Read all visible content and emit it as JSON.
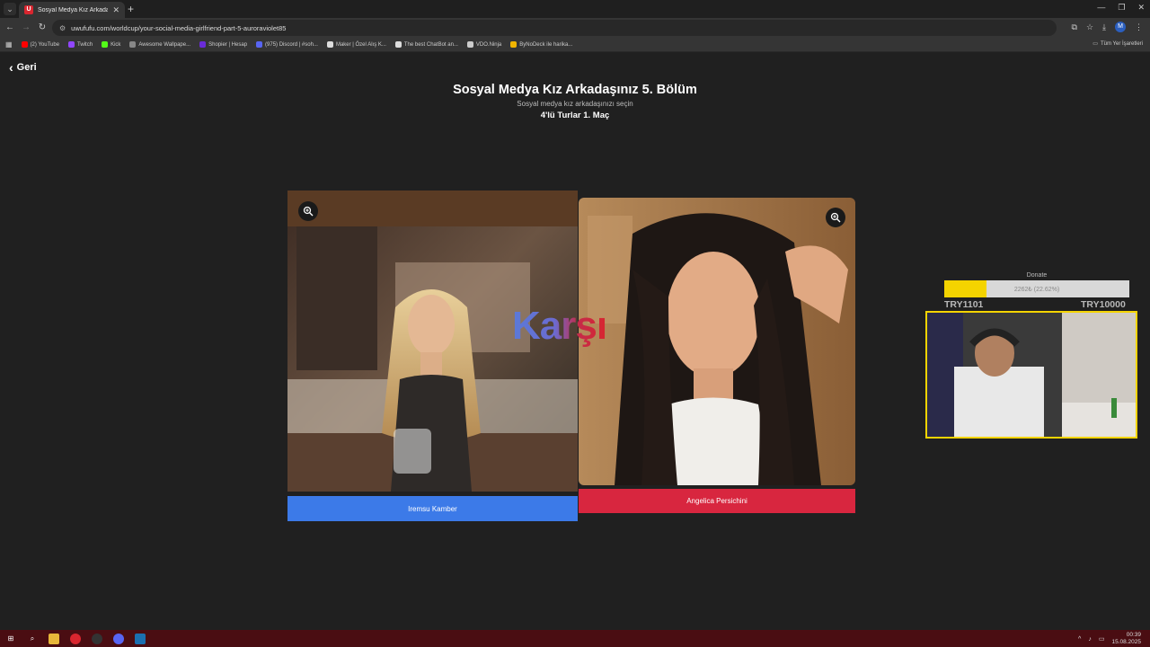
{
  "browser": {
    "tab_title": "Sosyal Medya Kız Arkadaşınız 5",
    "tab_favicon": "U",
    "url": "uwufufu.com/worldcup/your-social-media-girlfriend-part-5-auroraviolet85",
    "profile_initial": "M",
    "bookmarks": [
      {
        "label": "(2) YouTube",
        "icon": "youtube-icon",
        "color": "#ff0000"
      },
      {
        "label": "Twitch",
        "icon": "twitch-icon",
        "color": "#9146ff"
      },
      {
        "label": "Kick",
        "icon": "kick-icon",
        "color": "#53fc18"
      },
      {
        "label": "Awesome Wallpape...",
        "icon": "wallpaper-icon",
        "color": "#888888"
      },
      {
        "label": "Shopier | Hesap",
        "icon": "shopier-icon",
        "color": "#6a2bd8"
      },
      {
        "label": "(975) Discord | #soh...",
        "icon": "discord-icon",
        "color": "#5865f2"
      },
      {
        "label": "Maker | Özel Alış K...",
        "icon": "maker-icon",
        "color": "#dddddd"
      },
      {
        "label": "The best ChatBot an...",
        "icon": "chatbot-icon",
        "color": "#dddddd"
      },
      {
        "label": "VDO.Ninja",
        "icon": "vdoninja-icon",
        "color": "#cccccc"
      },
      {
        "label": "ByNoDeck ile harika...",
        "icon": "bynodeck-icon",
        "color": "#f0b400"
      }
    ],
    "all_bookmarks": "Tüm Yer İşaretleri"
  },
  "page": {
    "back_label": "Geri",
    "title": "Sosyal Medya Kız Arkadaşınız 5. Bölüm",
    "subtitle": "Sosyal medya kız arkadaşınızı seçin",
    "round": "4'lü Turlar 1. Maç",
    "vs_label": "Karşı",
    "left_name": "Iremsu Kamber",
    "right_name": "Angelica Persichini"
  },
  "donate": {
    "label": "Donate",
    "progress_text": "2262₺ (22.62%)",
    "progress_percent": 22.62,
    "min": "TRY1101",
    "max": "TRY10000"
  },
  "taskbar": {
    "time": "00:39",
    "date": "15.08.2025"
  },
  "colors": {
    "left_button": "#3c7ae8",
    "right_button": "#d8263f",
    "donate_fill": "#f4d400"
  }
}
